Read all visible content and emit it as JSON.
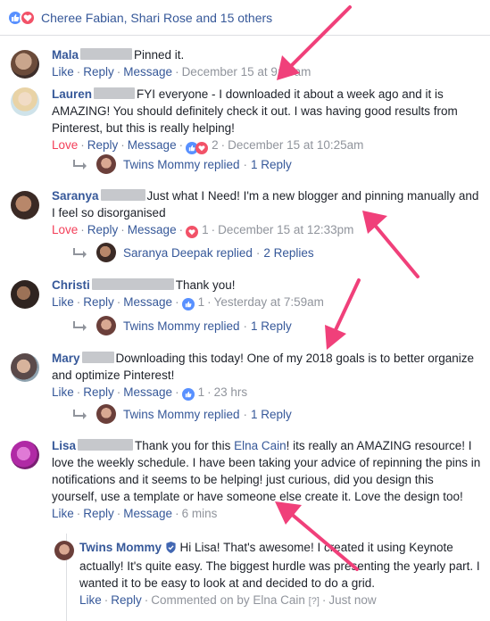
{
  "reactions": {
    "summary": "Cheree Fabian, Shari Rose and 15 others"
  },
  "comments": [
    {
      "author": "Mala",
      "text": "Pinned it.",
      "actions": {
        "like": "Like",
        "reply": "Reply",
        "message": "Message",
        "time": "December 15 at 9:43am"
      }
    },
    {
      "author": "Lauren",
      "text": "FYI everyone - I downloaded it about a week ago and it is AMAZING! You should definitely check it out. I was having good results from Pinterest, but this is really helping!",
      "actions": {
        "like": "Love",
        "reply": "Reply",
        "message": "Message",
        "count": "2",
        "time": "December 15 at 10:25am"
      },
      "replied": {
        "name": "Twins Mommy replied",
        "count": "1 Reply"
      }
    },
    {
      "author": "Saranya",
      "text": "Just what I Need! I'm a new blogger and pinning manually and I feel so disorganised",
      "actions": {
        "like": "Love",
        "reply": "Reply",
        "message": "Message",
        "count": "1",
        "time": "December 15 at 12:33pm"
      },
      "replied": {
        "name": "Saranya Deepak replied",
        "count": "2 Replies"
      }
    },
    {
      "author": "Christi",
      "text": "Thank you!",
      "actions": {
        "like": "Like",
        "reply": "Reply",
        "message": "Message",
        "count": "1",
        "time": "Yesterday at 7:59am"
      },
      "replied": {
        "name": "Twins Mommy replied",
        "count": "1 Reply"
      }
    },
    {
      "author": "Mary",
      "text": "Downloading this today! One of my 2018 goals is to better organize and optimize Pinterest!",
      "actions": {
        "like": "Like",
        "reply": "Reply",
        "message": "Message",
        "count": "1",
        "time": "23 hrs"
      },
      "replied": {
        "name": "Twins Mommy replied",
        "count": "1 Reply"
      }
    },
    {
      "author": "Lisa",
      "text_before": "Thank you for this",
      "mention": "Elna Cain",
      "text_after": "! its really an AMAZING resource! I love the weekly schedule. I have been taking your advice of repinning the pins in notifications and it seems to be helping! just curious, did you design this yourself, use a template or have someone else create it. Love the design too!",
      "actions": {
        "like": "Like",
        "reply": "Reply",
        "message": "Message",
        "time": "6 mins"
      }
    }
  ],
  "nested_reply": {
    "author": "Twins Mommy",
    "text": "Hi Lisa! That's awesome! I created it using Keynote actually! It's quite easy. The biggest hurdle was presenting the yearly part. I wanted it to be easy to look at and decided to do a grid.",
    "actions": {
      "like": "Like",
      "reply": "Reply",
      "commented": "Commented on by Elna Cain",
      "badge": "[?]",
      "time": "Just now"
    }
  },
  "colors": {
    "link": "#365899",
    "muted": "#90949c",
    "love": "#f33e58",
    "arrow": "#f0407a"
  }
}
